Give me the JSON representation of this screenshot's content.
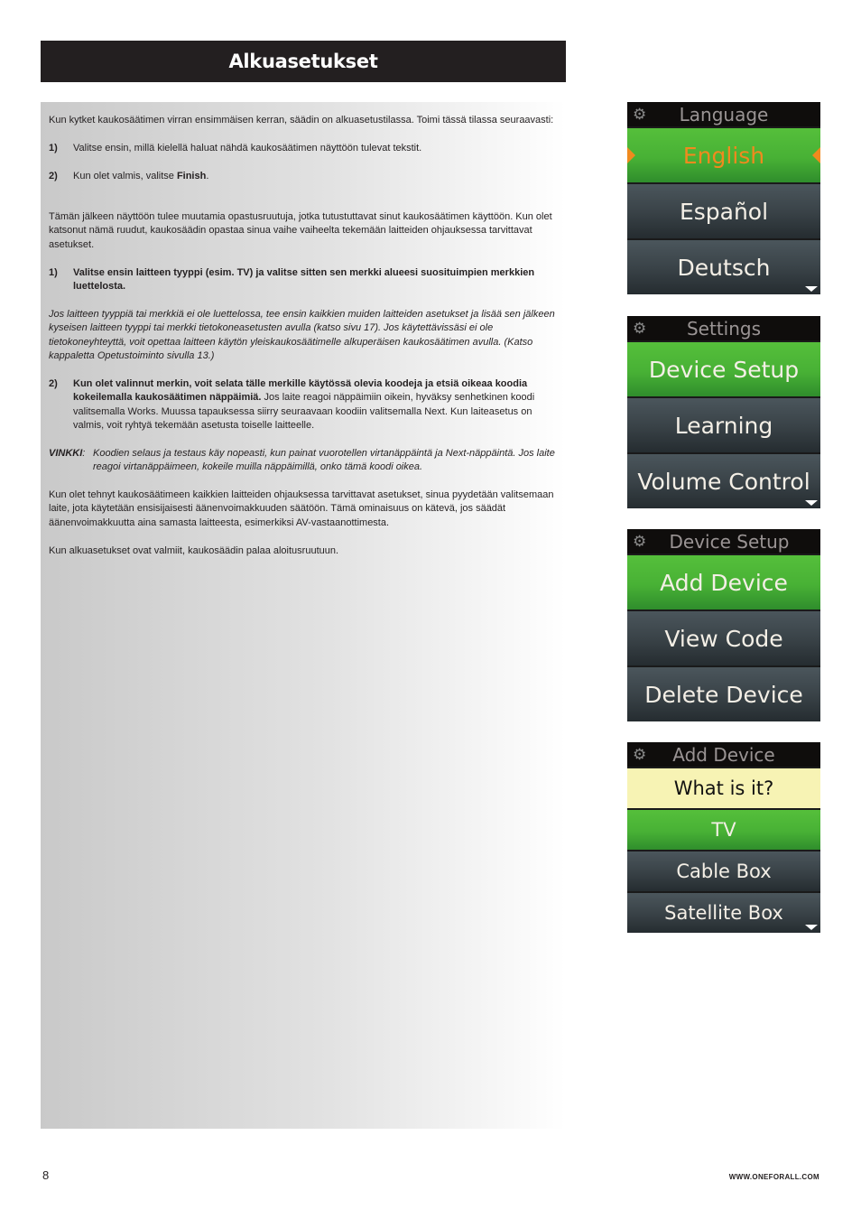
{
  "header": {
    "title": "Alkuasetukset"
  },
  "body": {
    "intro": "Kun kytket kaukosäätimen virran ensimmäisen kerran, säädin on alkuasetustilassa. Toimi tässä tilassa seuraavasti:",
    "steps_a": [
      {
        "num": "1)",
        "text": "Valitse ensin, millä kielellä haluat nähdä kaukosäätimen näyttöön tulevat tekstit."
      },
      {
        "num": "2)",
        "text_before": "Kun olet valmis, valitse ",
        "bold": "Finish",
        "text_after": "."
      }
    ],
    "para2": "Tämän jälkeen näyttöön tulee muutamia opastusruutuja, jotka tutustuttavat sinut kaukosäätimen käyttöön. Kun olet katsonut nämä ruudut, kaukosäädin opastaa sinua vaihe vaiheelta tekemään laitteiden ohjauksessa tarvittavat asetukset.",
    "step_b1": {
      "num": "1)",
      "bold": "Valitse ensin laitteen tyyppi (esim. TV) ja valitse sitten sen merkki alueesi suosituimpien merkkien luettelosta."
    },
    "italic_note": "Jos laitteen tyyppiä tai merkkiä ei ole luettelossa, tee ensin kaikkien muiden laitteiden asetukset ja lisää sen jälkeen kyseisen laitteen tyyppi tai merkki tietokoneasetusten avulla (katso sivu 17). Jos käytettävissäsi ei ole tietokoneyhteyttä, voit opettaa laitteen käytön yleiskaukosäätimelle alkuperäisen kaukosäätimen avulla. (Katso kappaletta Opetustoiminto sivulla 13.)",
    "step_b2": {
      "num": "2)",
      "bold": "Kun olet valinnut merkin, voit selata tälle merkille käytössä olevia koodeja ja etsiä oikeaa koodia kokeilemalla kaukosäätimen näppäimiä.",
      "text": " Jos laite reagoi näppäimiin oikein, hyväksy senhetkinen koodi valitsemalla Works. Muussa tapauksessa siirry seuraavaan koodiin valitsemalla Next. Kun laiteasetus on valmis, voit ryhtyä tekemään asetusta toiselle laitteelle."
    },
    "tip": {
      "label": "VINKKI",
      "text": "Koodien selaus ja testaus käy nopeasti, kun painat vuorotellen virtanäppäintä ja Next-näppäintä. Jos laite reagoi virtanäppäimeen, kokeile muilla näppäimillä, onko tämä koodi oikea."
    },
    "para3": "Kun olet tehnyt kaukosäätimeen kaikkien laitteiden ohjauksessa tarvittavat asetukset, sinua pyydetään valitsemaan laite, jota käytetään ensisijaisesti äänenvoimakkuuden säätöön. Tämä ominaisuus on kätevä, jos säädät äänenvoimakkuutta aina samasta laitteesta, esimerkiksi AV-vastaanottimesta.",
    "para4": "Kun alkuasetukset ovat valmiit, kaukosäädin palaa aloitusruutuun."
  },
  "screens": [
    {
      "title": "Language",
      "icon": "gear-icon",
      "items": [
        "English",
        "Español",
        "Deutsch"
      ],
      "selected": "English"
    },
    {
      "title": "Settings",
      "icon": "gear-icon",
      "items": [
        "Device Setup",
        "Learning",
        "Volume Control"
      ],
      "selected": "Device Setup"
    },
    {
      "title": "Device Setup",
      "icon": "gear-icon",
      "items": [
        "Add Device",
        "View Code",
        "Delete Device"
      ],
      "selected": "Add Device"
    },
    {
      "title": "Add Device",
      "icon": "gear-icon",
      "prompt": "What is it?",
      "items": [
        "TV",
        "Cable Box",
        "Satellite Box"
      ],
      "selected": "TV"
    }
  ],
  "footer": {
    "page_number": "8",
    "website": "WWW.ONEFORALL.COM"
  },
  "colors": {
    "title_bar": "#231f20",
    "green": "#48b135",
    "dark": "#3a4348",
    "orange": "#f08a1e",
    "yellow": "#f7f3b4"
  }
}
